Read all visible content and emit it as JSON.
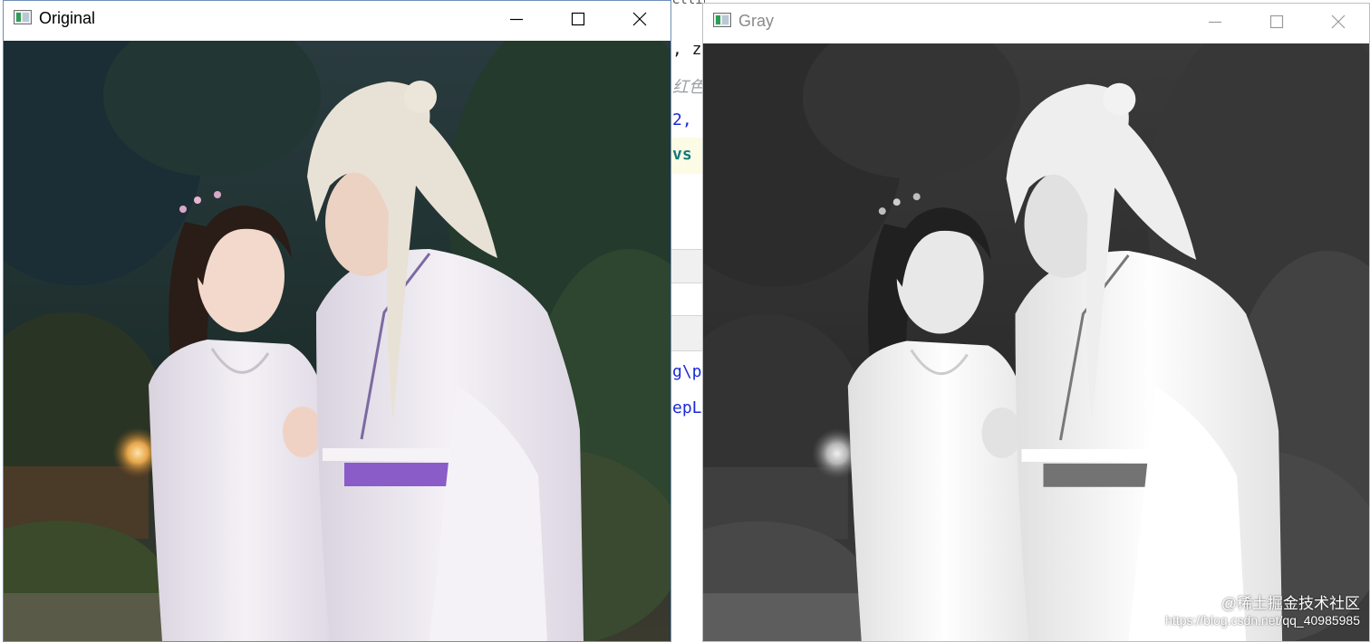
{
  "editor": {
    "lines": [
      "etting",
      ",  z",
      "红色",
      "2,",
      "vs",
      "g\\p",
      "epLe"
    ]
  },
  "windows": {
    "original": {
      "title": "Original"
    },
    "gray": {
      "title": "Gray"
    }
  },
  "controls": {
    "minimize_icon": "minimize-icon",
    "maximize_icon": "maximize-icon",
    "close_icon": "close-icon"
  },
  "watermark": {
    "line1": "@稀土掘金技术社区",
    "line2": "https://blog.csdn.net/qq_40985985"
  },
  "colors": {
    "accent_border": "#6f8fb8",
    "robe_white": "#ece8f0",
    "sash_purple": "#8a5cc8",
    "hair_silver": "#e8e2d6",
    "foliage_dark": "#1f3a3a"
  }
}
